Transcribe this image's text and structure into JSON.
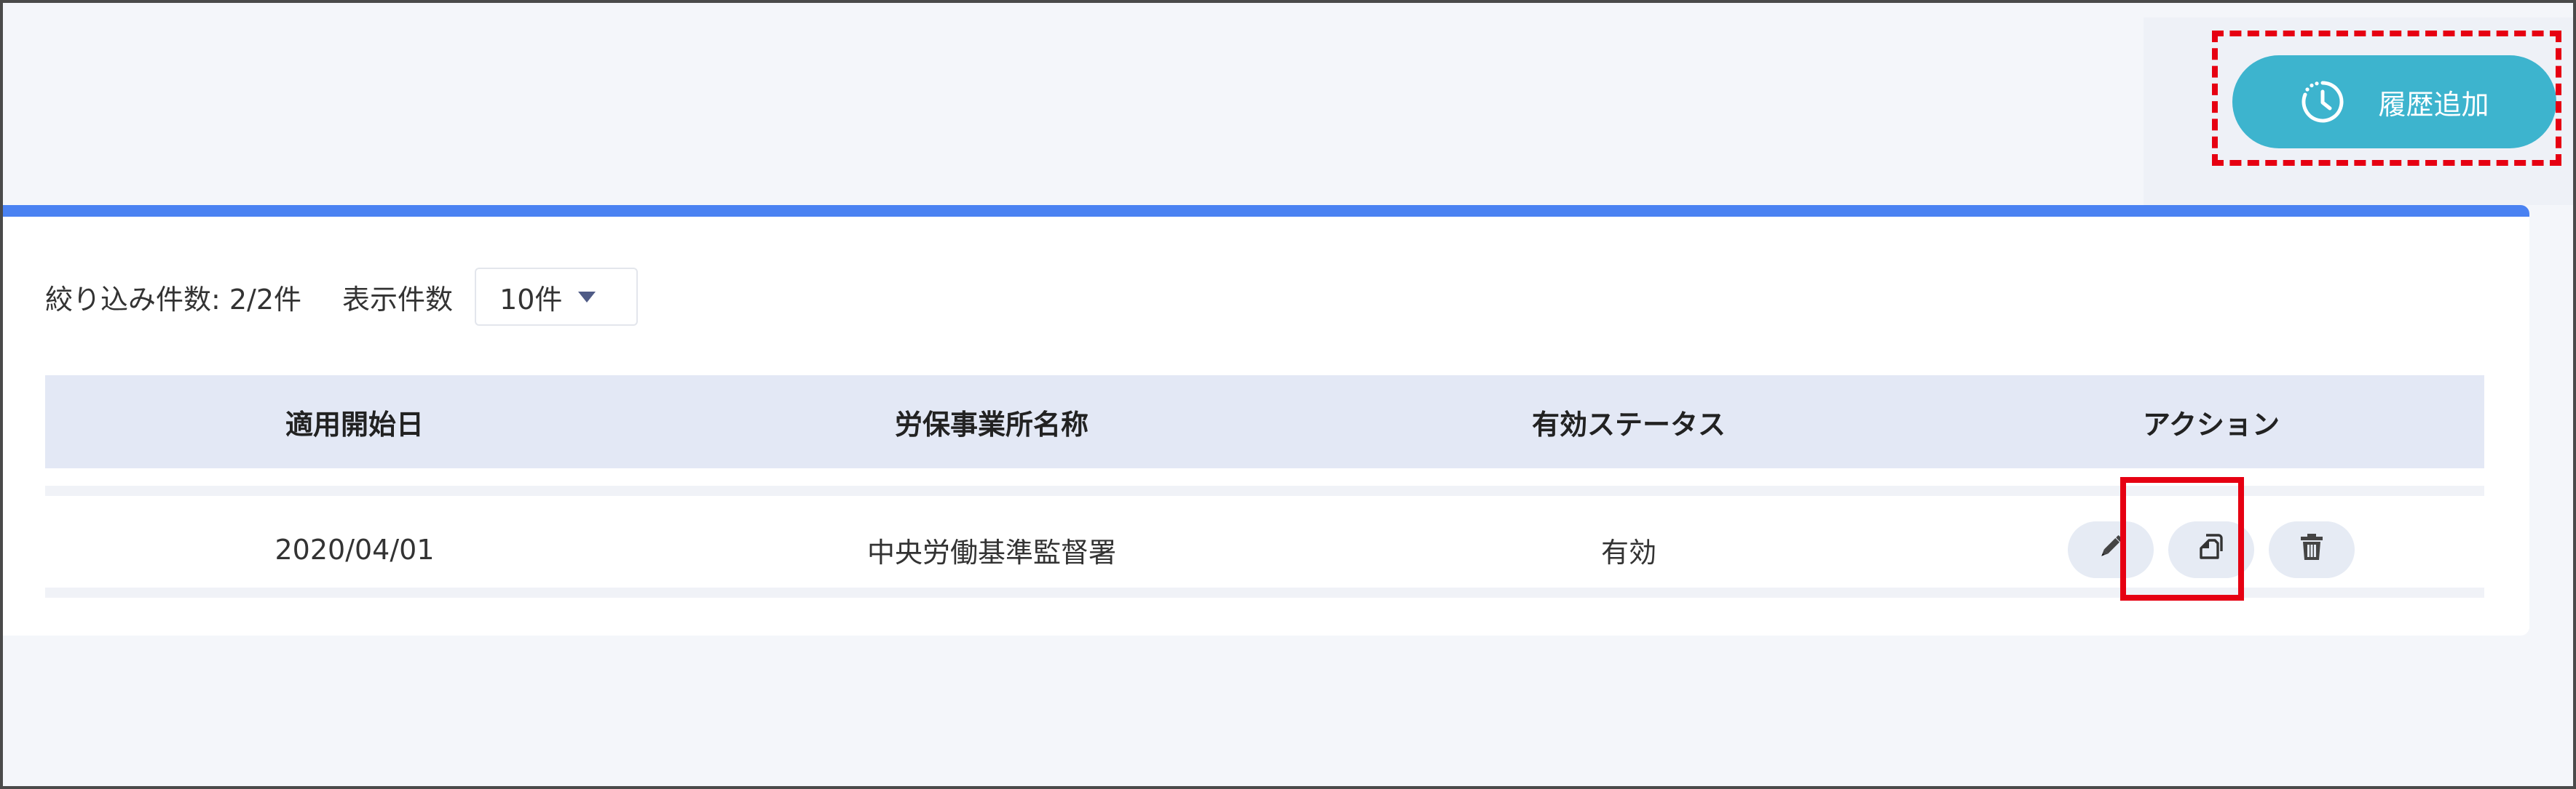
{
  "header": {
    "add_history_label": "履歴追加",
    "add_history_icon": "history-clock-icon",
    "accent_color": "#3db4ce",
    "card_top_border_color": "#4a82f2",
    "highlight_color": "#e60012"
  },
  "filter": {
    "count_label": "絞り込み件数: 2/2件",
    "per_page_label": "表示件数",
    "per_page_value": "10件"
  },
  "table": {
    "columns": [
      "適用開始日",
      "労保事業所名称",
      "有効ステータス",
      "アクション"
    ],
    "rows": [
      {
        "start_date": "2020/04/01",
        "office_name": "中央労働基準監督署",
        "status": "有効",
        "actions": [
          "edit-pencil-icon",
          "copy-icon",
          "delete-trash-icon"
        ]
      }
    ]
  }
}
